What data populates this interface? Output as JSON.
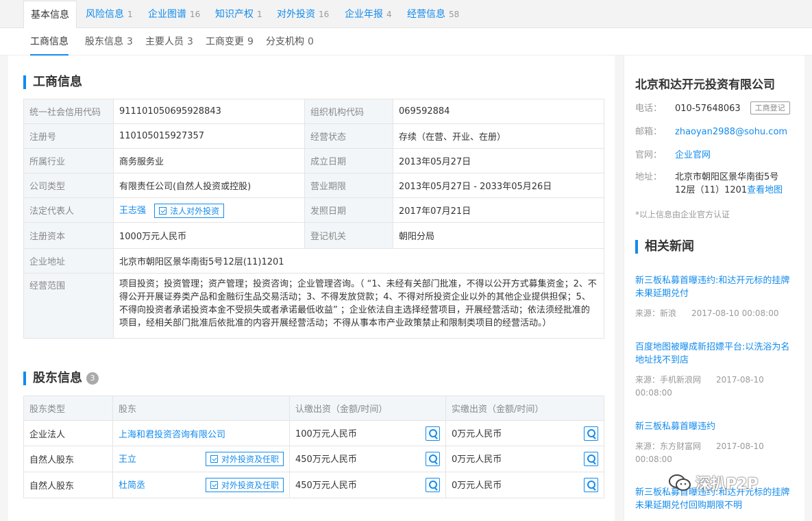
{
  "tabs": [
    {
      "label": "基本信息",
      "count": ""
    },
    {
      "label": "风险信息",
      "count": "1"
    },
    {
      "label": "企业图谱",
      "count": "16"
    },
    {
      "label": "知识产权",
      "count": "1"
    },
    {
      "label": "对外投资",
      "count": "16"
    },
    {
      "label": "企业年报",
      "count": "4"
    },
    {
      "label": "经营信息",
      "count": "58"
    }
  ],
  "subtabs": [
    {
      "label": "工商信息",
      "count": ""
    },
    {
      "label": "股东信息",
      "count": "3"
    },
    {
      "label": "主要人员",
      "count": "3"
    },
    {
      "label": "工商变更",
      "count": "9"
    },
    {
      "label": "分支机构",
      "count": "0"
    }
  ],
  "biz": {
    "title": "工商信息",
    "credit_code_label": "统一社会信用代码",
    "credit_code": "911101050695928843",
    "org_code_label": "组织机构代码",
    "org_code": "069592884",
    "reg_no_label": "注册号",
    "reg_no": "110105015927357",
    "status_label": "经营状态",
    "status": "存续（在营、开业、在册）",
    "industry_label": "所属行业",
    "industry": "商务服务业",
    "founded_label": "成立日期",
    "founded": "2013年05月27日",
    "type_label": "公司类型",
    "type": "有限责任公司(自然人投资或控股)",
    "term_label": "营业期限",
    "term": "2013年05月27日 - 2033年05月26日",
    "legal_label": "法定代表人",
    "legal": "王志强",
    "legal_btn": "法人对外投资",
    "license_date_label": "发照日期",
    "license_date": "2017年07月21日",
    "capital_label": "注册资本",
    "capital": "1000万元人民币",
    "authority_label": "登记机关",
    "authority": "朝阳分局",
    "address_label": "企业地址",
    "address": "北京市朝阳区景华南街5号12层(11)1201",
    "scope_label": "经营范围",
    "scope": "项目投资；投资管理；资产管理；投资咨询；企业管理咨询。（ “1、未经有关部门批准，不得以公开方式募集资金；2、不得公开开展证券类产品和金融衍生品交易活动；3、不得发放贷款；4、不得对所投资企业以外的其他企业提供担保；5、不得向投资者承诺投资本金不受损失或者承诺最低收益” ；企业依法自主选择经营项目，开展经营活动；依法须经批准的项目，经相关部门批准后依批准的内容开展经营活动；不得从事本市产业政策禁止和限制类项目的经营活动。）"
  },
  "holders": {
    "title": "股东信息",
    "count": "3",
    "headers": [
      "股东类型",
      "股东",
      "认缴出资（金额/时间）",
      "实缴出资（金额/时间）"
    ],
    "rows": [
      {
        "type": "企业法人",
        "name": "上海和君投资咨询有限公司",
        "btn": "",
        "subscribed": "100万元人民币",
        "paid": "0万元人民币"
      },
      {
        "type": "自然人股东",
        "name": "王立",
        "btn": "对外投资及任职",
        "subscribed": "450万元人民币",
        "paid": "0万元人民币"
      },
      {
        "type": "自然人股东",
        "name": "杜简丞",
        "btn": "对外投资及任职",
        "subscribed": "450万元人民币",
        "paid": "0万元人民币"
      }
    ]
  },
  "side": {
    "company": "北京和达开元投资有限公司",
    "phone_label": "电话：",
    "phone": "010-57648063",
    "phone_btn": "工商登记",
    "email_label": "邮箱：",
    "email": "zhaoyan2988@sohu.com",
    "site_label": "官网：",
    "site": "企业官网",
    "addr_label": "地址：",
    "addr_line1": "北京市朝阳区景华南街5号",
    "addr_line2": "12层（11）1201",
    "map_link": "查看地图",
    "note": "*以上信息由企业官方认证",
    "news_title": "相关新闻",
    "news": [
      {
        "title": "新三板私募首曝违约:和达开元标的挂牌未果延期兑付",
        "source": "来源：新浪",
        "time": "2017-08-10 00:08:00"
      },
      {
        "title": "百度地图被曝成新招嫖平台:以洗浴为名 地址找不到店",
        "source": "来源：手机新浪网",
        "time": "2017-08-10 00:08:00"
      },
      {
        "title": "新三板私募首曝违约",
        "source": "来源：东方财富网",
        "time": "2017-08-10 00:08:00"
      },
      {
        "title": "新三板私募首曝违约:和达开元标的挂牌未果延期兑付回购期限不明",
        "source": "",
        "time": ""
      }
    ]
  },
  "watermark": "深扒P2P"
}
